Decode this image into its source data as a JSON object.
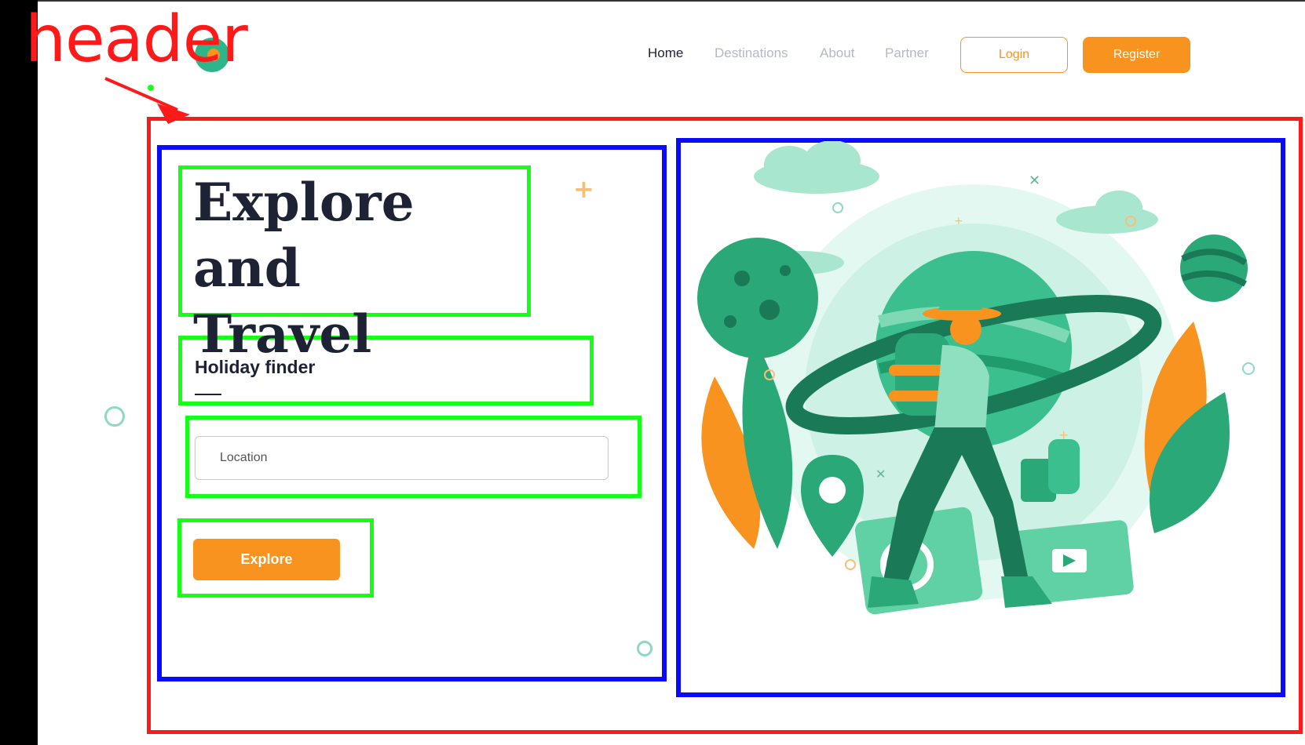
{
  "annotation": {
    "header_label": "header"
  },
  "nav": {
    "links": [
      {
        "label": "Home",
        "active": true
      },
      {
        "label": "Destinations",
        "active": false
      },
      {
        "label": "About",
        "active": false
      },
      {
        "label": "Partner",
        "active": false
      }
    ],
    "login_label": "Login",
    "register_label": "Register"
  },
  "hero": {
    "title_line1": "Explore and",
    "title_line2": "Travel",
    "finder_title": "Holiday finder",
    "location_placeholder": "Location",
    "explore_label": "Explore"
  },
  "colors": {
    "accent": "#f7931e",
    "teal": "#2fb58a",
    "dark_text": "#1e2235",
    "muted_text": "#b4b8c3",
    "annotation_red": "#ff1a1a",
    "annotation_blue": "#0a0aff",
    "annotation_green": "#16ff16"
  },
  "icons": [
    "logo-icon",
    "annotation-arrow-icon",
    "deco-ring-icon",
    "deco-plus-icon",
    "travel-illustration"
  ]
}
